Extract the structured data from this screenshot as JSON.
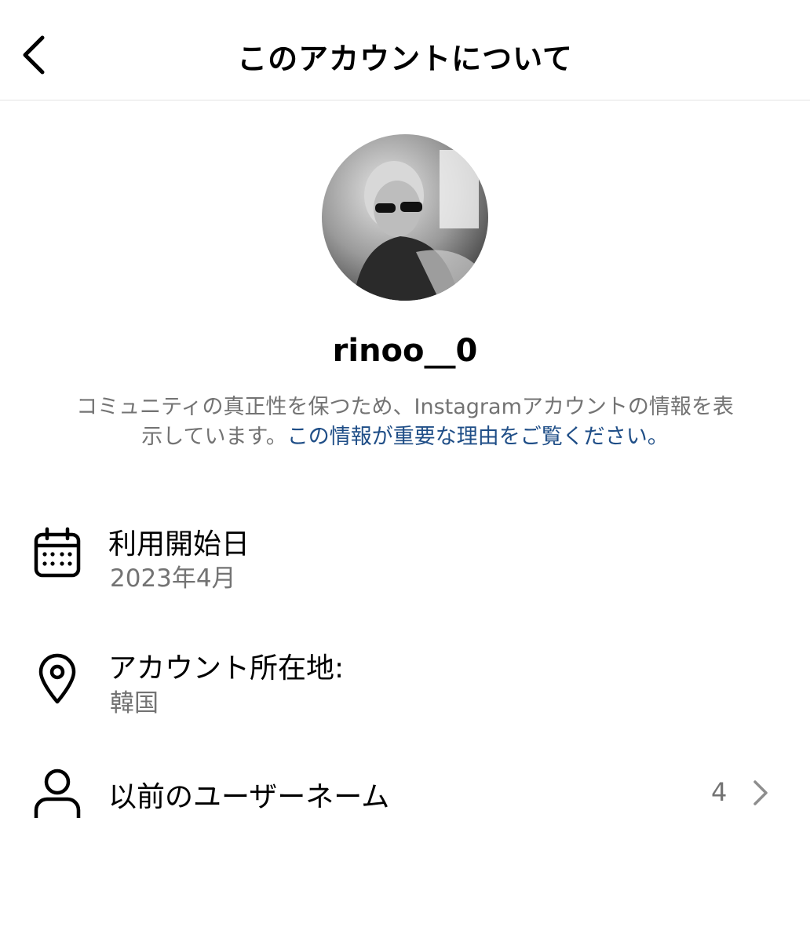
{
  "header": {
    "title": "このアカウントについて",
    "back_icon": "chevron-left-icon"
  },
  "profile": {
    "avatar_icon": "profile-photo",
    "username": "rinoo__0",
    "description_text": "コミュニティの真正性を保つため、Instagramアカウントの情報を表示しています。",
    "description_link": "この情報が重要な理由をご覧ください。"
  },
  "rows": {
    "joined": {
      "icon": "calendar-icon",
      "title": "利用開始日",
      "value": "2023年4月"
    },
    "location": {
      "icon": "location-pin-icon",
      "title": "アカウント所在地:",
      "value": "韓国"
    },
    "former_usernames": {
      "icon": "person-icon",
      "title": "以前のユーザーネーム",
      "count": "4",
      "chevron_icon": "chevron-right-icon"
    }
  },
  "colors": {
    "link": "#1f4e87",
    "secondary_text": "#737373",
    "divider": "#e3e3e3"
  }
}
